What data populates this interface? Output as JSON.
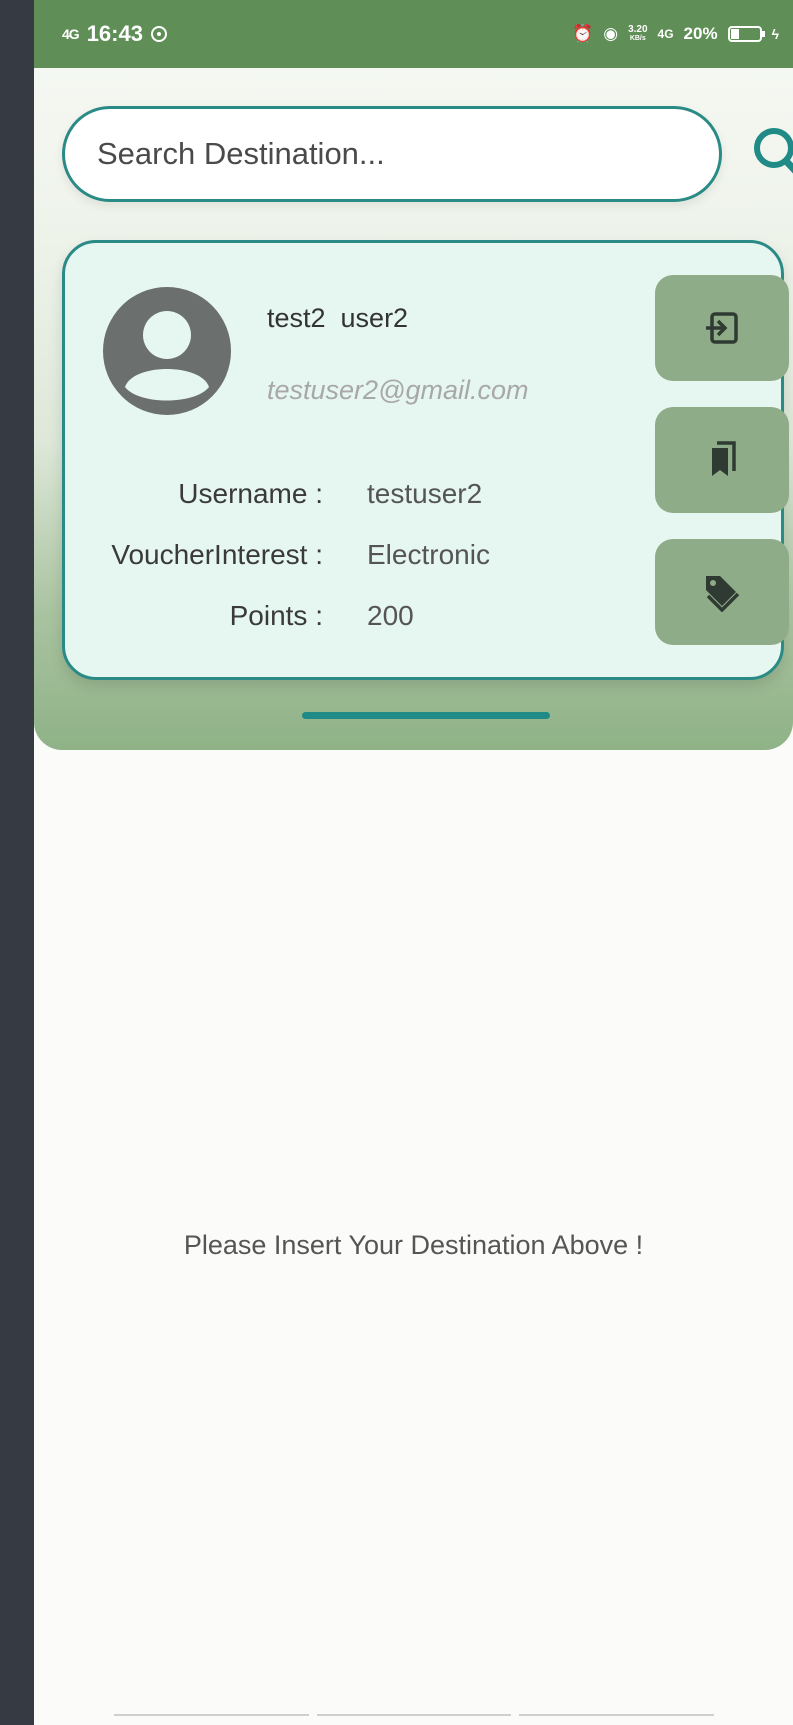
{
  "status_bar": {
    "network_left": "4G",
    "time": "16:43",
    "speed_top": "3.20",
    "speed_bottom": "KB/s",
    "network_right": "4G",
    "battery": "20%"
  },
  "search": {
    "placeholder": "Search Destination...",
    "value": ""
  },
  "profile": {
    "name": "test2  user2",
    "email": "testuser2@gmail.com",
    "fields": [
      {
        "label": "Username :",
        "value": "testuser2"
      },
      {
        "label": "VoucherInterest :",
        "value": "Electronic"
      },
      {
        "label": "Points :",
        "value": "200"
      }
    ]
  },
  "actions": [
    {
      "icon": "logout-icon"
    },
    {
      "icon": "bookmarks-icon"
    },
    {
      "icon": "tags-icon"
    }
  ],
  "main": {
    "empty_message": "Please Insert Your Destination Above !"
  },
  "colors": {
    "status_bar": "#5f8f57",
    "accent": "#2a8a86",
    "card_bg": "#e6f6f0",
    "button_bg": "#8fac88"
  }
}
